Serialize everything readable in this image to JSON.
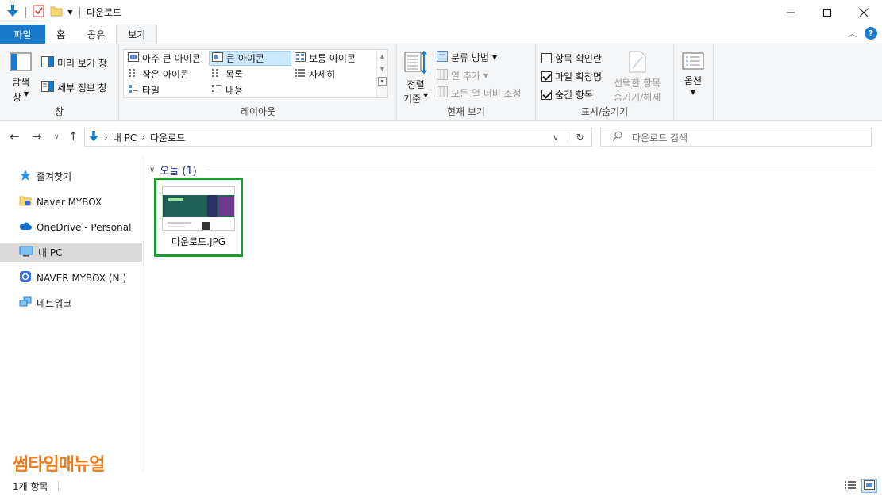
{
  "window": {
    "title": "다운로드"
  },
  "tabs": [
    {
      "label": "파일"
    },
    {
      "label": "홈"
    },
    {
      "label": "공유"
    },
    {
      "label": "보기"
    }
  ],
  "ribbon": {
    "panes": {
      "nav_pane_label": "탐색\n창",
      "nav_pane_line1": "탐색",
      "nav_pane_line2": "창",
      "preview_pane": "미리 보기 창",
      "details_pane": "세부 정보 창",
      "group_label": "창"
    },
    "layout": {
      "items": [
        {
          "label": "아주 큰 아이콘"
        },
        {
          "label": "큰 아이콘"
        },
        {
          "label": "보통 아이콘"
        },
        {
          "label": "작은 아이콘"
        },
        {
          "label": "목록"
        },
        {
          "label": "자세히"
        },
        {
          "label": "타일"
        },
        {
          "label": "내용"
        }
      ],
      "selected": "큰 아이콘",
      "group_label": "레이아웃"
    },
    "current_view": {
      "sort_line1": "정렬",
      "sort_line2": "기준",
      "group_by": "분류 방법",
      "add_columns": "열 추가",
      "fit_columns": "모든 열 너비 조정",
      "group_label": "현재 보기"
    },
    "show_hide": {
      "item_checkboxes": {
        "label": "항목 확인란",
        "checked": false
      },
      "file_extensions": {
        "label": "파일 확장명",
        "checked": true
      },
      "hidden_items": {
        "label": "숨긴 항목",
        "checked": true
      },
      "hide_selected_line1": "선택한 항목",
      "hide_selected_line2": "숨기기/해제",
      "group_label": "표시/숨기기"
    },
    "options": {
      "label": "옵션"
    }
  },
  "address": {
    "crumbs": [
      "내 PC",
      "다운로드"
    ],
    "search_placeholder": "다운로드 검색"
  },
  "sidebar": {
    "items": [
      {
        "label": "즐겨찾기"
      },
      {
        "label": "Naver MYBOX"
      },
      {
        "label": "OneDrive - Personal"
      },
      {
        "label": "내 PC"
      },
      {
        "label": "NAVER MYBOX (N:)"
      },
      {
        "label": "네트워크"
      }
    ],
    "selected": "내 PC"
  },
  "content": {
    "group_header": "오늘 (1)",
    "files": [
      {
        "name": "다운로드.JPG"
      }
    ]
  },
  "watermark": "썸타임매뉴얼",
  "status": {
    "item_count": "1개 항목"
  },
  "colors": {
    "accent": "#1979ca",
    "selection": "#1a9c2e",
    "brand": "#f07c1a"
  }
}
